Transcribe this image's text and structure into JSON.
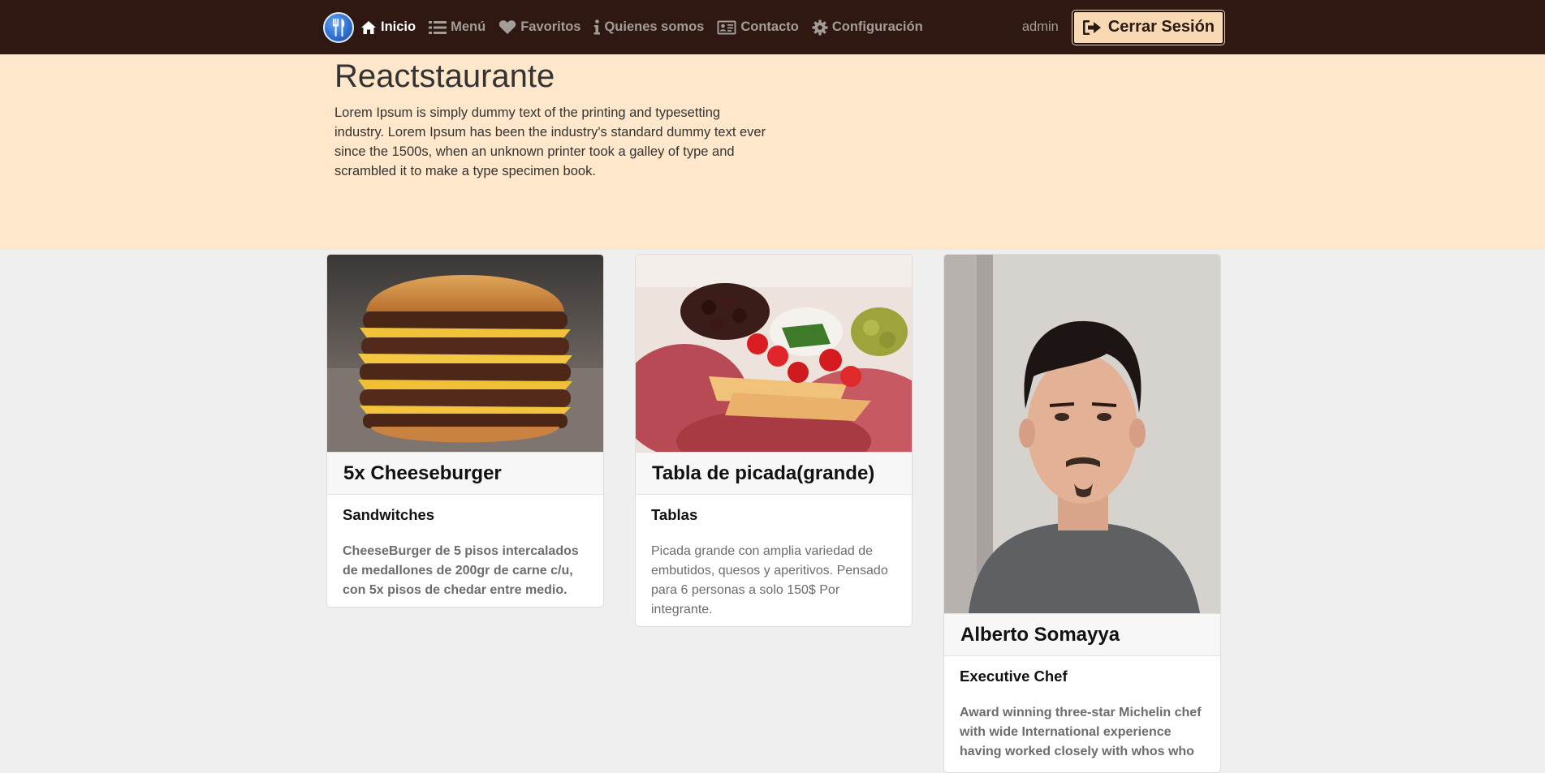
{
  "nav": {
    "links": [
      {
        "label": "Inicio",
        "icon": "home-icon",
        "active": true
      },
      {
        "label": "Menú",
        "icon": "list-icon",
        "active": false
      },
      {
        "label": "Favoritos",
        "icon": "heart-icon",
        "active": false
      },
      {
        "label": "Quienes somos",
        "icon": "info-icon",
        "active": false
      },
      {
        "label": "Contacto",
        "icon": "id-card-icon",
        "active": false
      },
      {
        "label": "Configuración",
        "icon": "gear-icon",
        "active": false
      }
    ],
    "username": "admin",
    "logout_label": "Cerrar Sesión"
  },
  "hero": {
    "title": "Reactstaurante",
    "text": "Lorem Ipsum is simply dummy text of the printing and typesetting industry. Lorem Ipsum has been the industry's standard dummy text ever since the 1500s, when an unknown printer took a galley of type and scrambled it to make a type specimen book."
  },
  "cards": [
    {
      "title": "5x Cheeseburger",
      "subtitle": "Sandwitches",
      "text": "CheeseBurger de 5 pisos intercalados de medallones de 200gr de carne c/u, con 5x pisos de chedar entre medio."
    },
    {
      "title": "Tabla de picada(grande)",
      "subtitle": "Tablas",
      "text": "Picada grande con amplia variedad de embutidos, quesos y aperitivos. Pensado para 6 personas a solo 150$ Por integrante."
    },
    {
      "title": "Alberto Somayya",
      "subtitle": "Executive Chef",
      "text": "Award winning three-star Michelin chef with wide International experience having worked closely with whos who"
    }
  ],
  "colors": {
    "navbar": "#2e1811",
    "hero": "#ffe7cb",
    "logout_button": "#f8d9b4",
    "page": "#efefef"
  }
}
